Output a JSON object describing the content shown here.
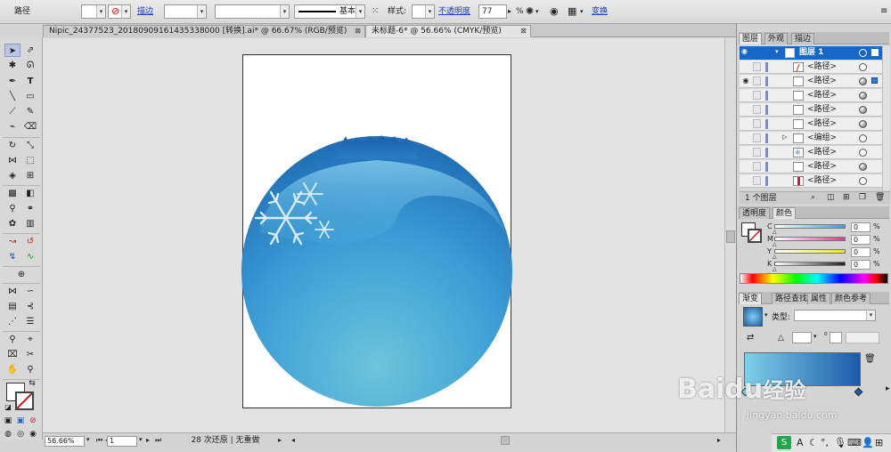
{
  "control_bar": {
    "object_type": "路径",
    "stroke_link": "描边",
    "stroke_style": "基本",
    "style_label": "样式:",
    "opacity_link": "不透明度",
    "opacity_value": "77",
    "opacity_unit": "%",
    "transform_link": "变换"
  },
  "document_tabs": [
    {
      "title": "Nipic_24377523_20180909161435338000 [转换].ai* @ 66.67% (RGB/预览)",
      "active": false
    },
    {
      "title": "未标题-6* @ 56.66% (CMYK/预览)",
      "active": true
    }
  ],
  "status": {
    "zoom": "56.66%",
    "page": "1",
    "undo_info": "28 次还原 | 无重做"
  },
  "layers_panel": {
    "tabs": [
      "图层",
      "外观",
      "描边"
    ],
    "layer_name": "图层 1",
    "rows": [
      {
        "name": "<路径>",
        "visible": false,
        "expand": false,
        "target_filled": false,
        "thumb": "red-line"
      },
      {
        "name": "<路径>",
        "visible": true,
        "expand": false,
        "target_filled": true,
        "thumb": "blank"
      },
      {
        "name": "<路径>",
        "visible": false,
        "expand": false,
        "target_filled": true,
        "thumb": "blank"
      },
      {
        "name": "<路径>",
        "visible": false,
        "expand": false,
        "target_filled": true,
        "thumb": "blank"
      },
      {
        "name": "<路径>",
        "visible": false,
        "expand": false,
        "target_filled": true,
        "thumb": "blank"
      },
      {
        "name": "<编组>",
        "visible": false,
        "expand": true,
        "target_filled": false,
        "thumb": "blank"
      },
      {
        "name": "<路径>",
        "visible": false,
        "expand": false,
        "target_filled": false,
        "thumb": "snow"
      },
      {
        "name": "<路径>",
        "visible": false,
        "expand": false,
        "target_filled": true,
        "thumb": "blank"
      },
      {
        "name": "<路径>",
        "visible": false,
        "expand": false,
        "target_filled": false,
        "thumb": "red-bar"
      }
    ],
    "footer": "1 个图层"
  },
  "color_panel": {
    "tabs": [
      "透明度",
      "颜色"
    ],
    "channels": [
      {
        "label": "C",
        "value": "0",
        "color": "#2fa6d8"
      },
      {
        "label": "M",
        "value": "0",
        "color": "#d63e8e"
      },
      {
        "label": "Y",
        "value": "0",
        "color": "#f2e52a"
      },
      {
        "label": "K",
        "value": "0",
        "color": "#222222"
      }
    ],
    "percent": "%"
  },
  "gradient_panel": {
    "tabs": [
      "渐变",
      "路径查找",
      "属性",
      "颜色参考"
    ],
    "type_label": "类型:",
    "stop_color_left": "#7fd0ea",
    "stop_color_right": "#1e5aa8"
  },
  "artwork": {
    "ball_top_color": "#1f6db6",
    "ball_bottom_color": "#6cc5d9"
  },
  "watermark": {
    "brand": "Baidu",
    "brand_cn": "经验",
    "url": "jingyan.baidu.com"
  }
}
